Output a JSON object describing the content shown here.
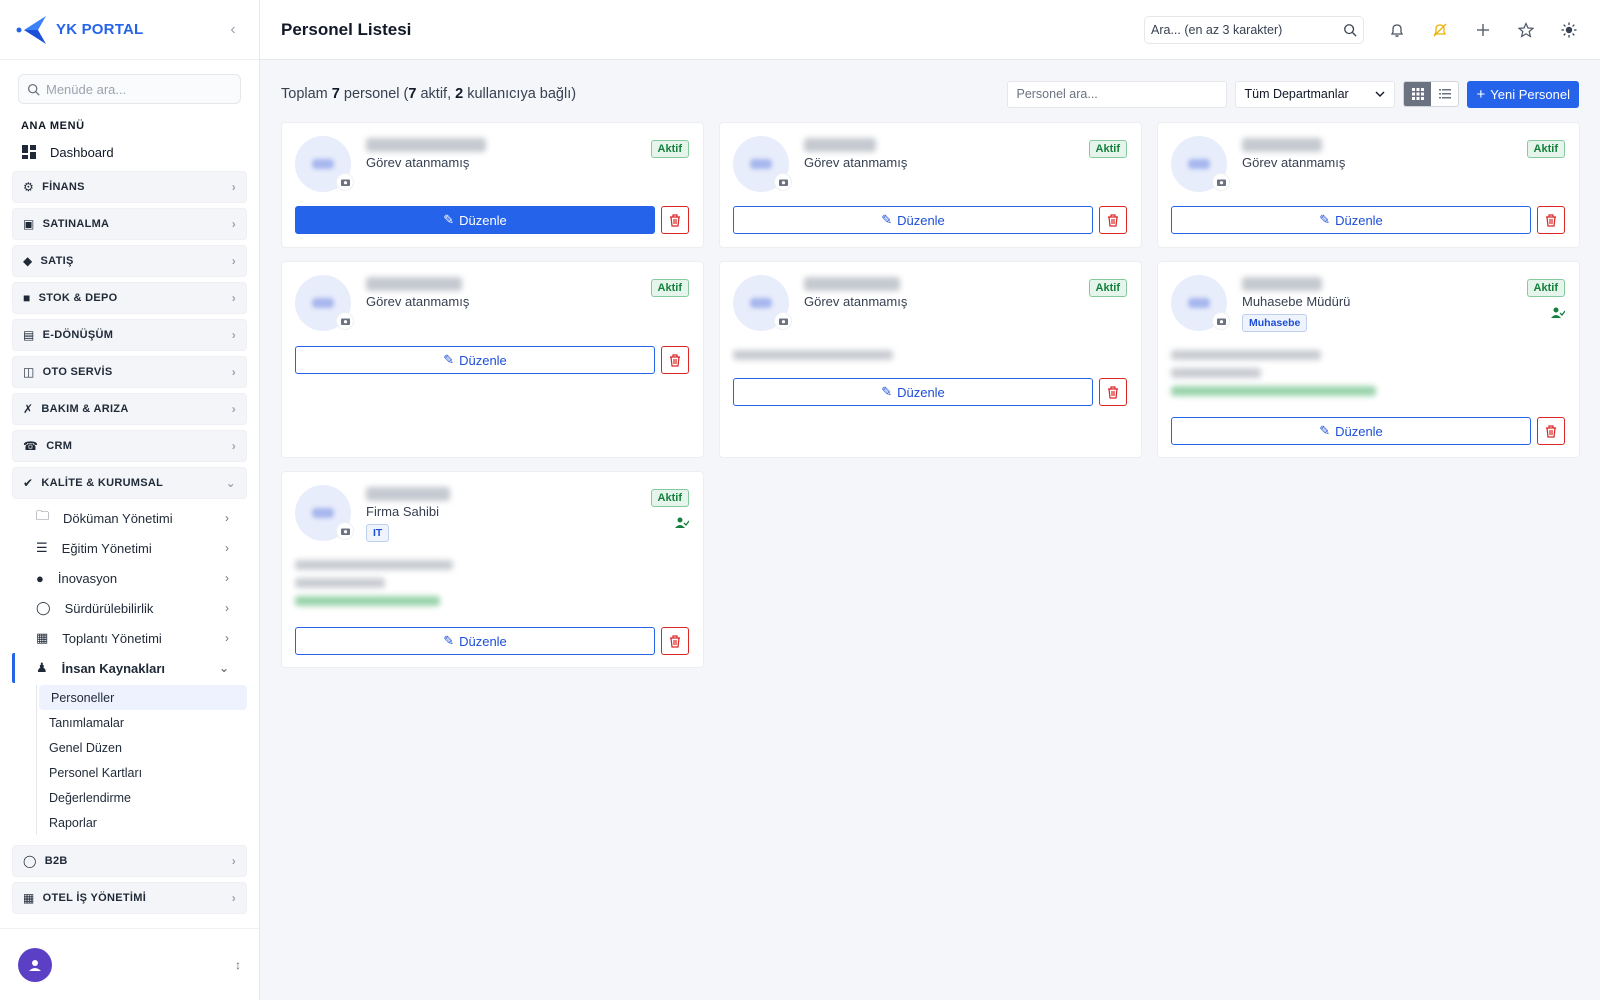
{
  "app": {
    "brand": "YK PORTAL"
  },
  "sidebar": {
    "search_placeholder": "Menüde ara...",
    "section": "ANA MENÜ",
    "dashboard": "Dashboard",
    "groups_top": [
      "FİNANS",
      "SATINALMA",
      "SATIŞ",
      "STOK & DEPO",
      "E-DÖNÜŞÜM",
      "OTO SERVİS",
      "BAKIM & ARIZA",
      "CRM"
    ],
    "open_group": "KALİTE & KURUMSAL",
    "sub_items": [
      "Döküman Yönetimi",
      "Eğitim Yönetimi",
      "İnovasyon",
      "Sürdürülebilirlik",
      "Toplantı Yönetimi"
    ],
    "active_sub": "İnsan Kaynakları",
    "leaves": [
      "Personeller",
      "Tanımlamalar",
      "Genel Düzen",
      "Personel Kartları",
      "Değerlendirme",
      "Raporlar"
    ],
    "groups_bottom": [
      "B2B",
      "OTEL İŞ YÖNETİMİ"
    ]
  },
  "header": {
    "title": "Personel Listesi",
    "search_placeholder": "Ara... (en az 3 karakter)"
  },
  "toolbar": {
    "summary": {
      "p1": "Toplam ",
      "total": "7",
      "p2": " personel (",
      "active": "7",
      "p3": " aktif, ",
      "linked": "2",
      "p4": " kullanıcıya bağlı)"
    },
    "search_placeholder": "Personel ara...",
    "department_filter": "Tüm Departmanlar",
    "new_button": "Yeni Personel"
  },
  "cards": [
    {
      "role": "Görev atanmamış",
      "status": "Aktif",
      "edit": "Düzenle"
    },
    {
      "role": "Görev atanmamış",
      "status": "Aktif",
      "edit": "Düzenle"
    },
    {
      "role": "Görev atanmamış",
      "status": "Aktif",
      "edit": "Düzenle"
    },
    {
      "role": "Görev atanmamış",
      "status": "Aktif",
      "edit": "Düzenle"
    },
    {
      "role": "Görev atanmamış",
      "status": "Aktif",
      "edit": "Düzenle"
    },
    {
      "role": "Muhasebe Müdürü",
      "department": "Muhasebe",
      "status": "Aktif",
      "edit": "Düzenle"
    },
    {
      "role": "Firma Sahibi",
      "department": "IT",
      "status": "Aktif",
      "edit": "Düzenle"
    }
  ]
}
